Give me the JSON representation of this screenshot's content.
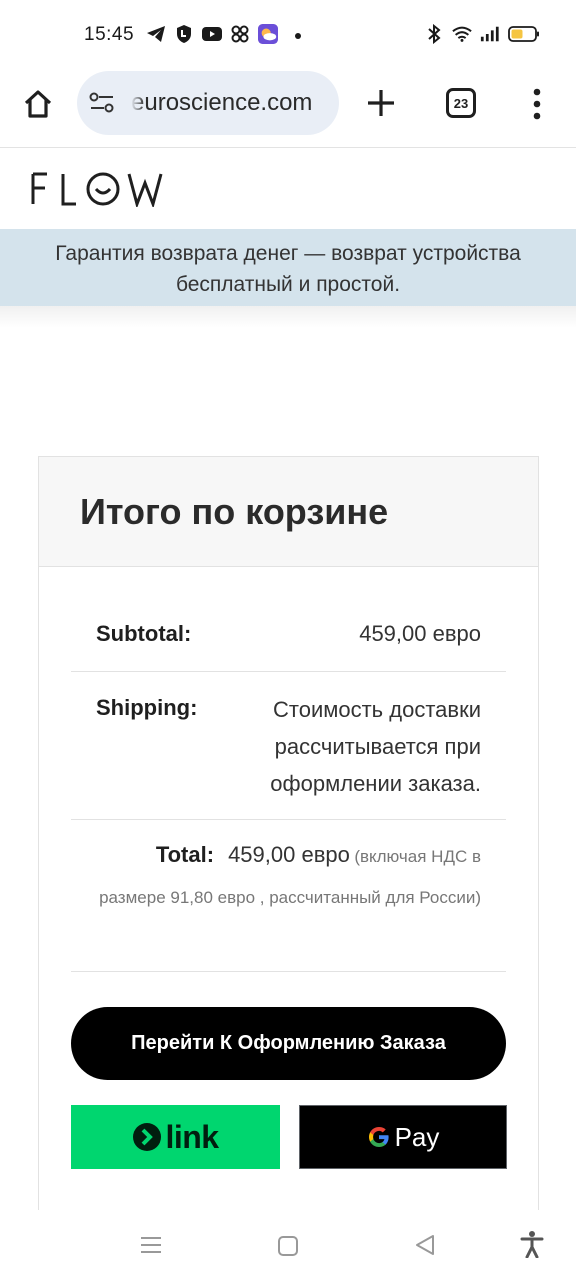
{
  "status_bar": {
    "time": "15:45",
    "left_icons": [
      "telegram-icon",
      "shield-icon",
      "youtube-icon",
      "pinwheel-icon",
      "weather-app-icon",
      "more-dot-icon"
    ],
    "right_icons": [
      "bluetooth-icon",
      "wifi-icon",
      "signal-icon",
      "battery-icon"
    ],
    "battery_level": 0.45,
    "battery_color": "#f5c542"
  },
  "browser": {
    "url": "euroscience.com",
    "tab_count": "23",
    "url_bar_color": "#e9eef6"
  },
  "site": {
    "logo_text": "FLOW",
    "banner_line1": "Гарантия возврата денег — возврат устройства",
    "banner_line2": "бесплатный и простой.",
    "banner_color": "#d4e3ec"
  },
  "cart_totals": {
    "title": "Итого по корзине",
    "subtotal_label": "Subtotal:",
    "subtotal_value": "459,00 евро",
    "shipping_label": "Shipping:",
    "shipping_value": "Стоимость доставки рассчитывается при оформлении заказа.",
    "total_label": "Total:",
    "total_value": "459,00 евро",
    "total_tax_note": "(включая НДС в размере 91,80 евро , рассчитанный для России)",
    "checkout_button": "Перейти К Оформлению Заказа",
    "link_button": "link",
    "gpay_button": "Pay",
    "link_color": "#00d66f"
  },
  "nav_bar": {
    "icons": [
      "menu-icon",
      "home-icon",
      "back-icon",
      "accessibility-icon"
    ]
  }
}
